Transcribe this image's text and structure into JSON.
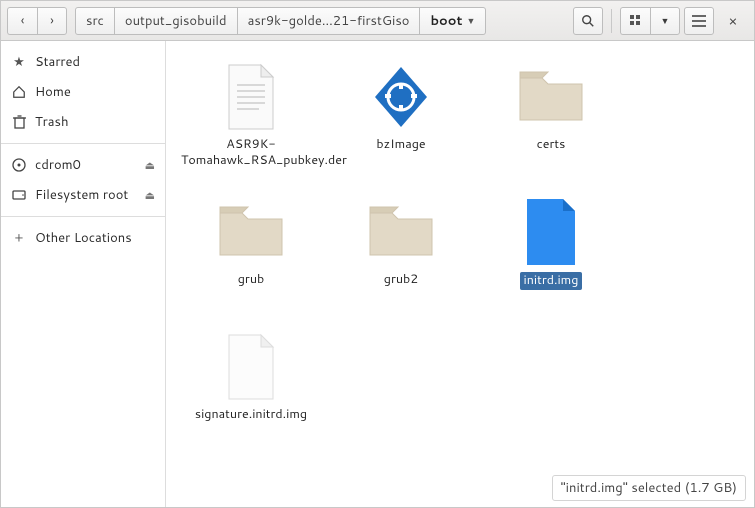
{
  "toolbar": {
    "path_segments": [
      "src",
      "output_gisobuild",
      "asr9k-golde...21-firstGiso",
      "boot"
    ],
    "active_index": 3
  },
  "sidebar": {
    "items": [
      {
        "icon": "star",
        "label": "Starred",
        "eject": false
      },
      {
        "icon": "home",
        "label": "Home",
        "eject": false
      },
      {
        "icon": "trash",
        "label": "Trash",
        "eject": false
      }
    ],
    "mounts": [
      {
        "icon": "disc",
        "label": "cdrom0",
        "eject": true
      },
      {
        "icon": "drive",
        "label": "Filesystem root",
        "eject": true
      }
    ],
    "other": {
      "label": "Other Locations"
    }
  },
  "files": [
    {
      "name": "ASR9K-Tomahawk_RSA_pubkey.der",
      "type": "text",
      "selected": false
    },
    {
      "name": "bzImage",
      "type": "binary",
      "selected": false
    },
    {
      "name": "certs",
      "type": "folder",
      "selected": false
    },
    {
      "name": "grub",
      "type": "folder",
      "selected": false
    },
    {
      "name": "grub2",
      "type": "folder",
      "selected": false
    },
    {
      "name": "initrd.img",
      "type": "image",
      "selected": true
    },
    {
      "name": "signature.initrd.img",
      "type": "blank",
      "selected": false
    }
  ],
  "status": {
    "text": "\"initrd.img\" selected (1.7 GB)"
  }
}
